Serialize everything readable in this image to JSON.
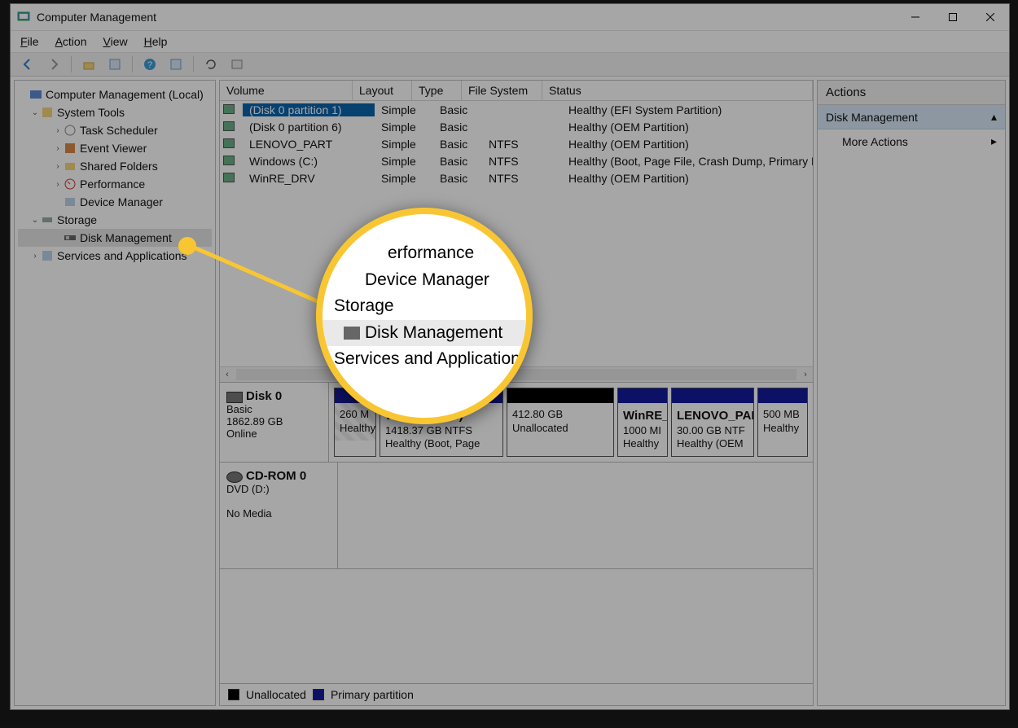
{
  "window_title": "Computer Management",
  "menu": {
    "file": "File",
    "action": "Action",
    "view": "View",
    "help": "Help"
  },
  "tree": {
    "root": "Computer Management (Local)",
    "system_tools": "System Tools",
    "task_scheduler": "Task Scheduler",
    "event_viewer": "Event Viewer",
    "shared_folders": "Shared Folders",
    "performance": "Performance",
    "device_manager": "Device Manager",
    "storage": "Storage",
    "disk_management": "Disk Management",
    "services": "Services and Applications"
  },
  "volcols": {
    "volume": "Volume",
    "layout": "Layout",
    "type": "Type",
    "fs": "File System",
    "status": "Status"
  },
  "vols": [
    {
      "name": "(Disk 0 partition 1)",
      "layout": "Simple",
      "type": "Basic",
      "fs": "",
      "status": "Healthy (EFI System Partition)"
    },
    {
      "name": "(Disk 0 partition 6)",
      "layout": "Simple",
      "type": "Basic",
      "fs": "",
      "status": "Healthy (OEM Partition)"
    },
    {
      "name": "LENOVO_PART",
      "layout": "Simple",
      "type": "Basic",
      "fs": "NTFS",
      "status": "Healthy (OEM Partition)"
    },
    {
      "name": "Windows (C:)",
      "layout": "Simple",
      "type": "Basic",
      "fs": "NTFS",
      "status": "Healthy (Boot, Page File, Crash Dump, Primary Partition)"
    },
    {
      "name": "WinRE_DRV",
      "layout": "Simple",
      "type": "Basic",
      "fs": "NTFS",
      "status": "Healthy (OEM Partition)"
    }
  ],
  "disk0": {
    "title": "Disk 0",
    "type": "Basic",
    "size": "1862.89 GB",
    "state": "Online",
    "parts": [
      {
        "title": "",
        "l1": "260 M",
        "l2": "Healthy"
      },
      {
        "title": "Windows  (C:)",
        "l1": "1418.37 GB NTFS",
        "l2": "Healthy (Boot, Page"
      },
      {
        "title": "",
        "l1": "412.80 GB",
        "l2": "Unallocated"
      },
      {
        "title": "WinRE_",
        "l1": "1000 MI",
        "l2": "Healthy"
      },
      {
        "title": "LENOVO_PAI",
        "l1": "30.00 GB NTF",
        "l2": "Healthy (OEM"
      },
      {
        "title": "",
        "l1": "500 MB",
        "l2": "Healthy"
      }
    ]
  },
  "cdrom": {
    "title": "CD-ROM 0",
    "l1": "DVD (D:)",
    "l2": "No Media"
  },
  "legend": {
    "unalloc": "Unallocated",
    "primary": "Primary partition"
  },
  "actions": {
    "header": "Actions",
    "group": "Disk Management",
    "more": "More Actions"
  },
  "zoom": {
    "r1": "erformance",
    "r2": "Device Manager",
    "r3": "Storage",
    "r4": "Disk Management",
    "r5": "Services and Applications"
  }
}
